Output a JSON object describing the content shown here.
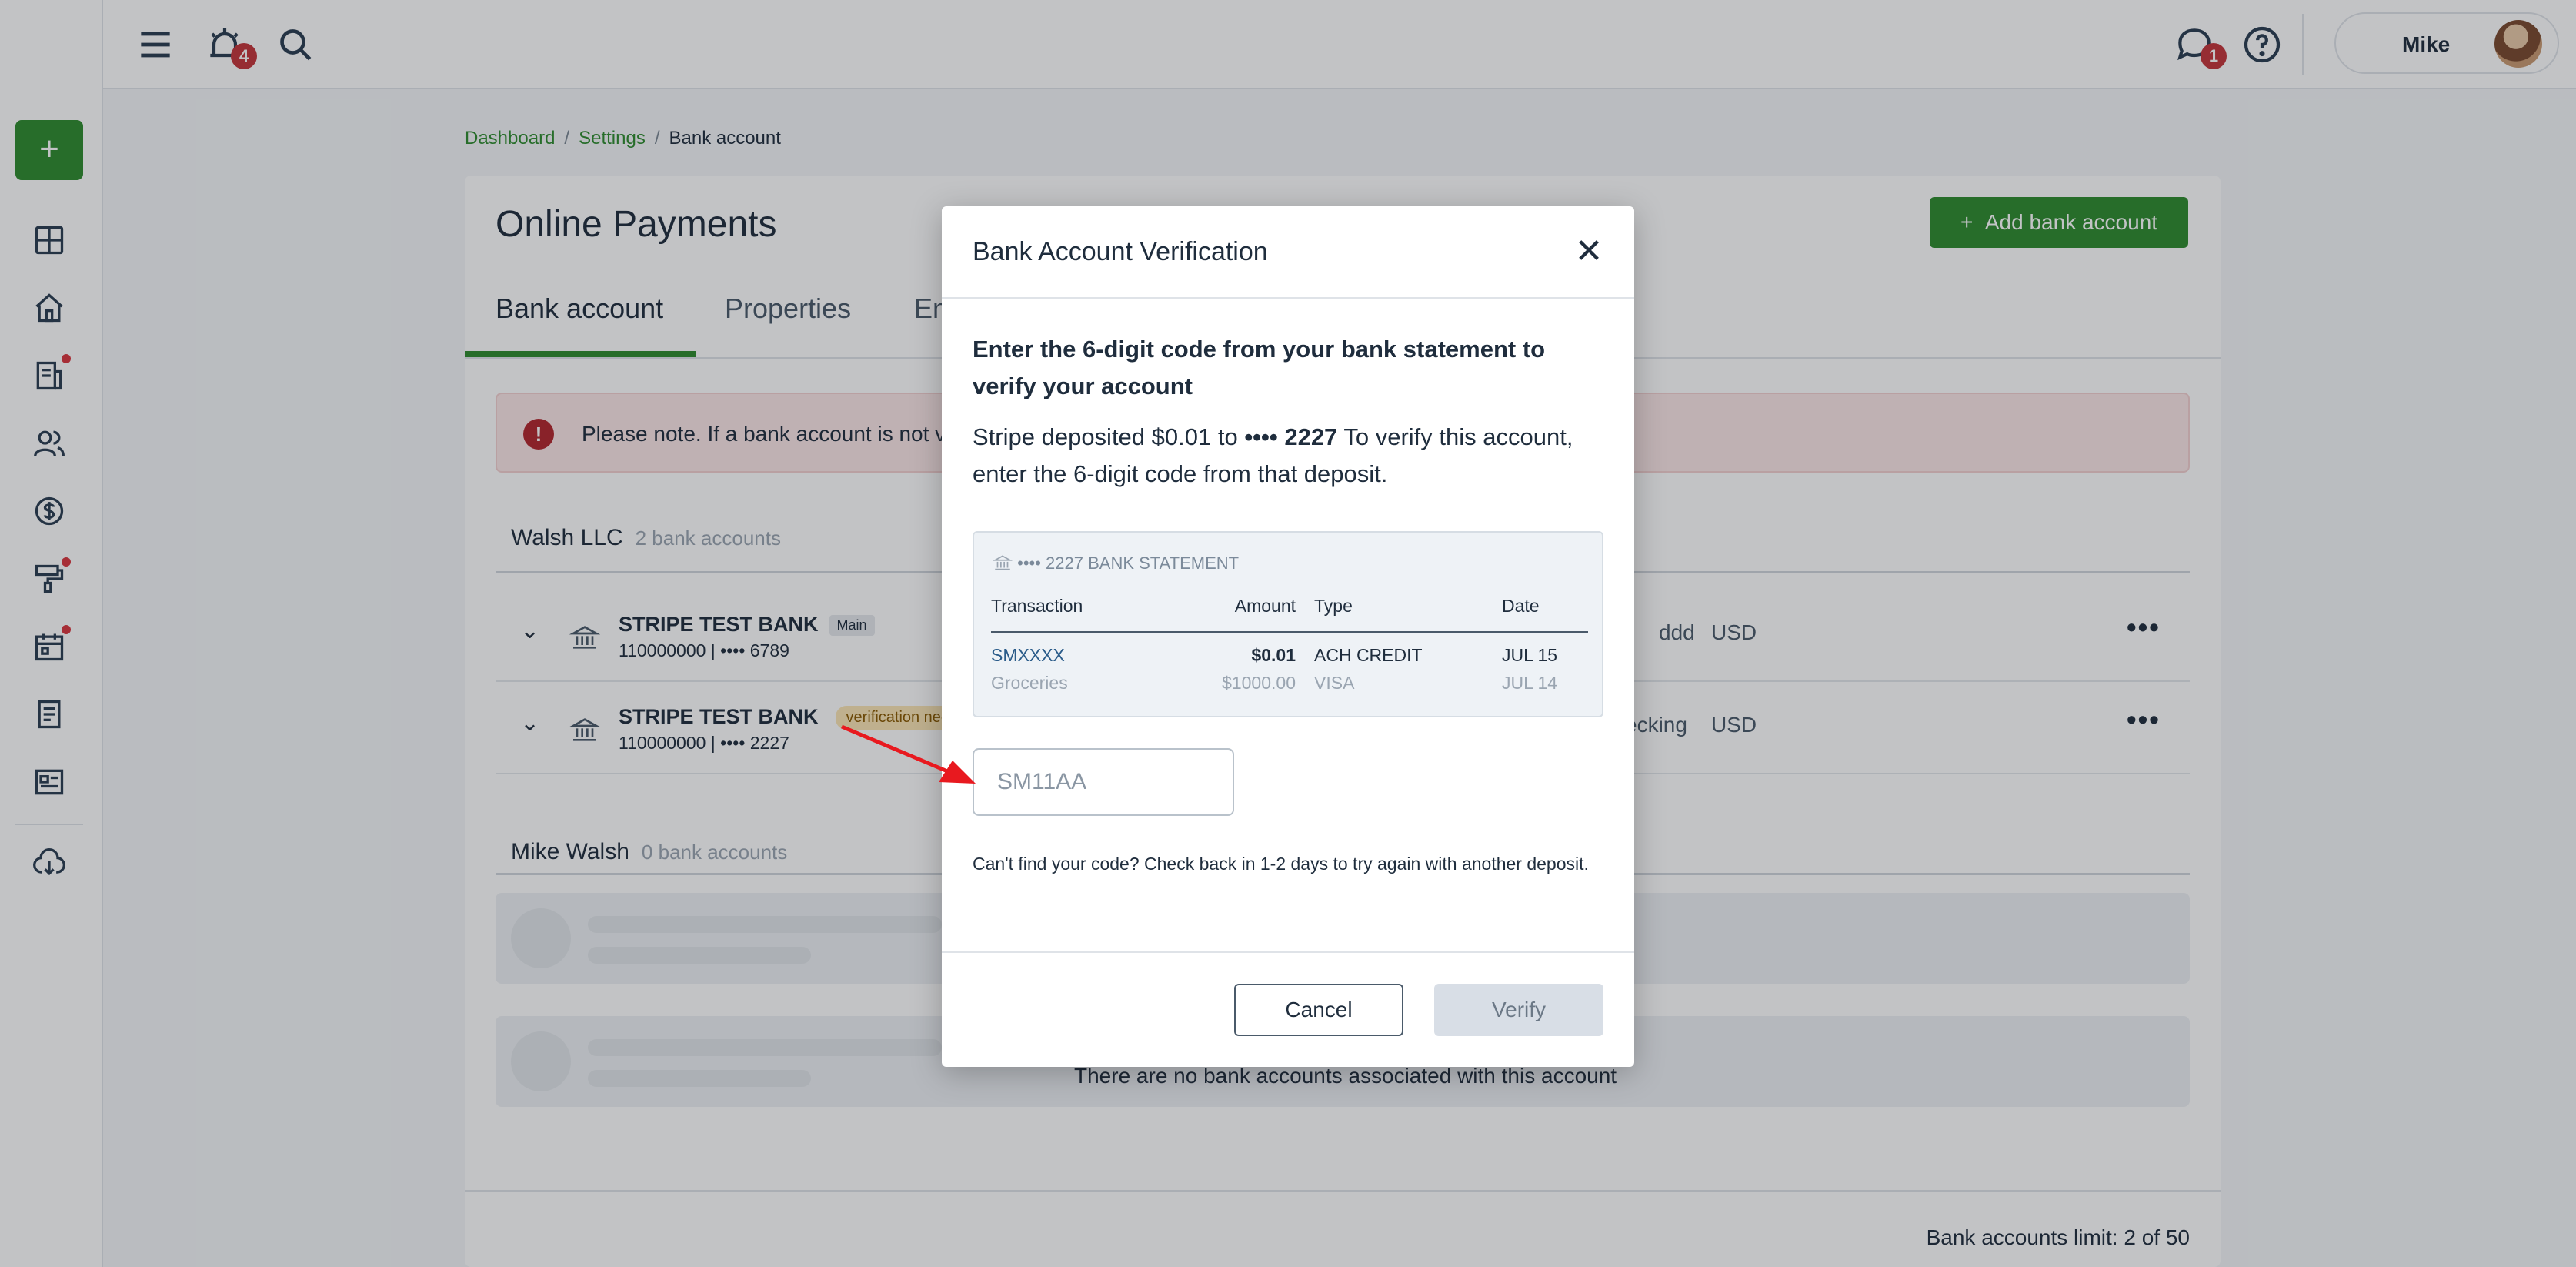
{
  "topbar": {
    "alerts_count": "4",
    "messages_count": "1",
    "user_name": "Mike"
  },
  "breadcrumb": {
    "items": [
      "Dashboard",
      "Settings",
      "Bank account"
    ],
    "separator": "/"
  },
  "page": {
    "title": "Online Payments",
    "add_bank_label": "Add bank account",
    "tabs": [
      {
        "label": "Bank account",
        "active": true
      },
      {
        "label": "Properties",
        "active": false
      },
      {
        "label": "En",
        "active": false
      }
    ],
    "alert_text": "Please note. If a bank account is not ve",
    "groups": [
      {
        "name": "Walsh LLC",
        "count": "2 bank accounts",
        "accounts": [
          {
            "name": "STRIPE TEST BANK",
            "tag": "Main",
            "number": "110000000 | •••• 6789",
            "type": "ddd",
            "currency": "USD"
          },
          {
            "name": "STRIPE TEST BANK",
            "tag": "verification nee",
            "number": "110000000 | •••• 2227",
            "type": "ecking",
            "currency": "USD"
          }
        ]
      },
      {
        "name": "Mike Walsh",
        "count": "0 bank accounts",
        "empty_text": "There are no bank accounts associated with this account"
      }
    ],
    "limit_text": "Bank accounts limit: 2 of 50"
  },
  "modal": {
    "title": "Bank Account Verification",
    "close_glyph": "✕",
    "heading": "Enter the 6-digit code from your bank statement to verify your account",
    "desc_prefix": "Stripe deposited $0.01 to ",
    "desc_account": "•••• 2227",
    "desc_suffix": " To verify this account, enter the 6-digit code from that deposit.",
    "statement": {
      "header": "•••• 2227 BANK STATEMENT",
      "columns": [
        "Transaction",
        "Amount",
        "Type",
        "Date"
      ],
      "rows": [
        {
          "transaction": "SMXXXX",
          "amount": "$0.01",
          "type": "ACH CREDIT",
          "date": "JUL 15"
        },
        {
          "transaction": "Groceries",
          "amount": "$1000.00",
          "type": "VISA",
          "date": "JUL 14"
        }
      ]
    },
    "code_placeholder": "SM11AA",
    "help_text": "Can't find your code? Check back in 1-2 days to try again with another deposit.",
    "cancel_label": "Cancel",
    "verify_label": "Verify"
  },
  "colors": {
    "brand_green": "#2e8b2e",
    "alert_red": "#b3262d",
    "badge_red": "#c4353b",
    "annotation_arrow": "#e8191f"
  }
}
